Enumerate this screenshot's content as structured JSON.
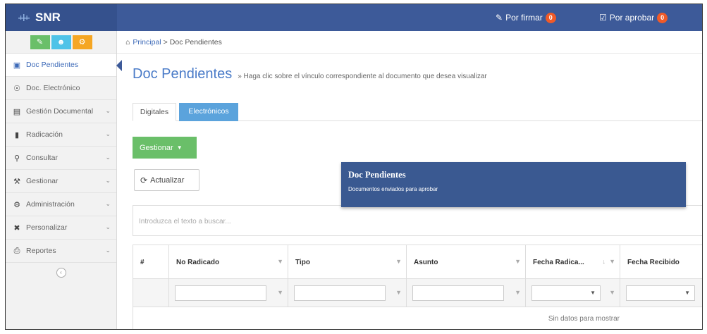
{
  "app": {
    "name": "SNR"
  },
  "topbar": {
    "por_firmar": {
      "label": "Por firmar",
      "count": "0"
    },
    "por_aprobar": {
      "label": "Por aprobar",
      "count": "0"
    }
  },
  "sidebar": {
    "quick_buttons": [
      {
        "icon": "pencil-icon",
        "color": "#6abf69"
      },
      {
        "icon": "users-icon",
        "color": "#4fc3e8"
      },
      {
        "icon": "gears-icon",
        "color": "#f5a623"
      }
    ],
    "items": [
      {
        "label": "Doc Pendientes",
        "icon": "inbox-icon",
        "active": true
      },
      {
        "label": "Doc. Electrónico",
        "icon": "globe-icon"
      },
      {
        "label": "Gestión Documental",
        "icon": "documents-icon"
      },
      {
        "label": "Radicación",
        "icon": "file-icon"
      },
      {
        "label": "Consultar",
        "icon": "search-icon"
      },
      {
        "label": "Gestionar",
        "icon": "gavel-icon"
      },
      {
        "label": "Administración",
        "icon": "gears-icon"
      },
      {
        "label": "Personalizar",
        "icon": "wrench-icon"
      },
      {
        "label": "Reportes",
        "icon": "print-icon"
      }
    ]
  },
  "breadcrumb": {
    "home": "Principal",
    "separator": ">",
    "current": "Doc Pendientes"
  },
  "page": {
    "title": "Doc Pendientes",
    "subtitle": "» Haga clic sobre el vínculo correspondiente al documento que desea visualizar"
  },
  "tabs": [
    {
      "label": "Digitales",
      "active": true
    },
    {
      "label": "Electrónicos",
      "active": false
    }
  ],
  "actions": {
    "gestionar": "Gestionar",
    "actualizar": "Actualizar"
  },
  "tooltip": {
    "title": "Doc Pendientes",
    "text": "Documentos enviados para aprobar"
  },
  "search": {
    "placeholder": "Introduzca el texto a buscar..."
  },
  "grid": {
    "columns": [
      "#",
      "No Radicado",
      "Tipo",
      "Asunto",
      "Fecha Radica...",
      "Fecha Recibido"
    ],
    "empty_message": "Sin datos para mostrar"
  },
  "colors": {
    "header": "#3d5a99",
    "accent": "#4a7bc8",
    "green": "#6abf69",
    "tooltip": "#3a5991"
  }
}
